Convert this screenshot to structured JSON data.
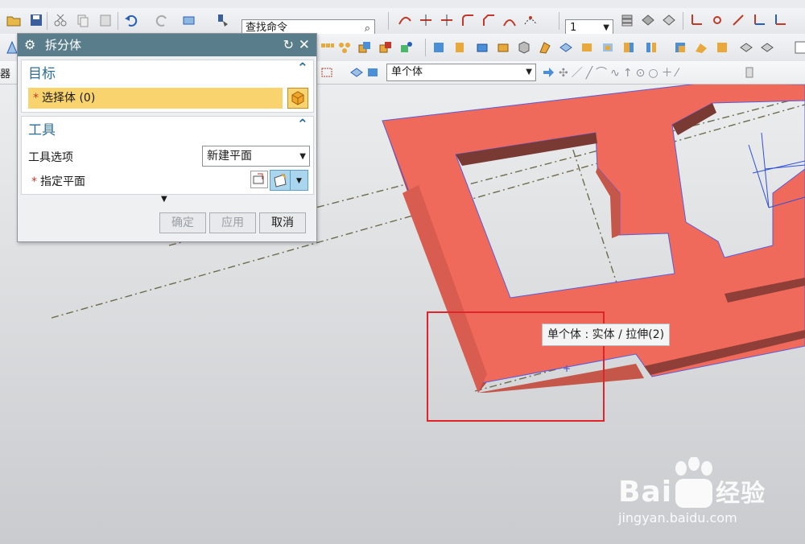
{
  "toolbar": {
    "command_search": "查找命令",
    "layer_value": "1",
    "selection_filter": "单个体"
  },
  "left_cut_label": "器",
  "dialog": {
    "title": "拆分体",
    "target": {
      "header": "目标",
      "select_body_label": "选择体 (0)"
    },
    "tool": {
      "header": "工具",
      "option_label": "工具选项",
      "option_value": "新建平面",
      "plane_label": "指定平面"
    },
    "buttons": {
      "ok": "确定",
      "apply": "应用",
      "cancel": "取消"
    }
  },
  "tooltip": "单个体 : 实体 / 拉伸(2)",
  "watermark": {
    "brand": "Bai",
    "brand_tail": "经验",
    "url": "jingyan.baidu.com"
  },
  "colors": {
    "part_face": "#f06a5c",
    "part_side": "#b84a40",
    "dialog_title": "#5a7d8c",
    "selection_row": "#f9d36d",
    "highlight_box": "#e0242a"
  }
}
